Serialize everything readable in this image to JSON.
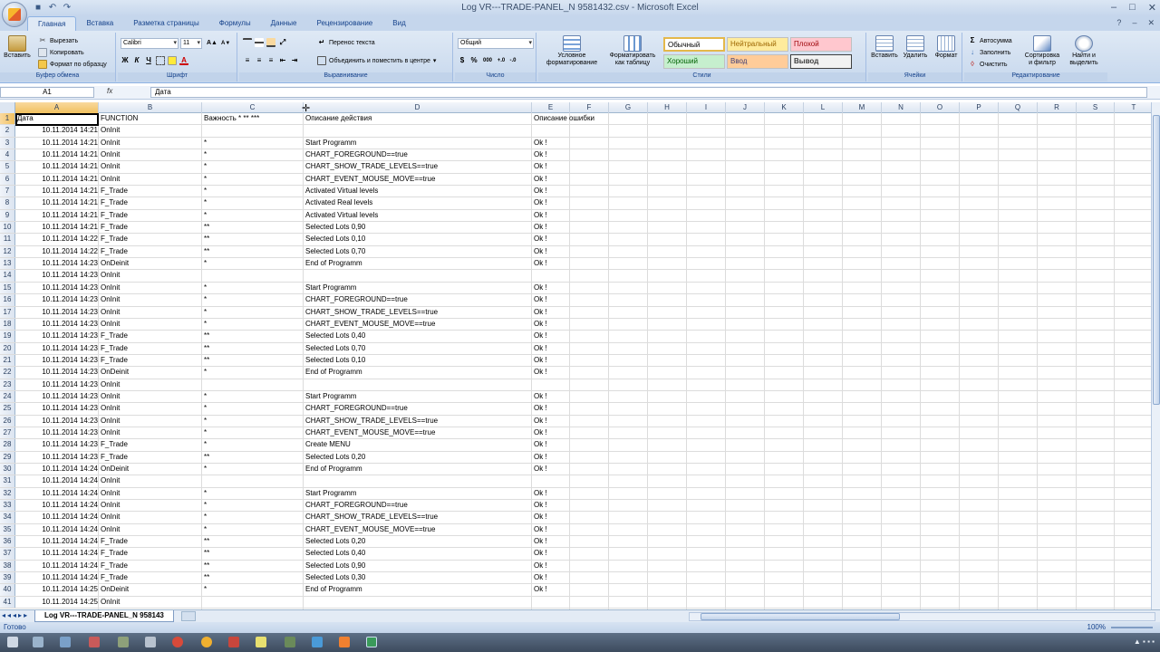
{
  "window": {
    "title": "Log VR---TRADE-PANEL_N 9581432.csv - Microsoft Excel",
    "controls": [
      "–",
      "□",
      "✕"
    ]
  },
  "tabs": [
    "Главная",
    "Вставка",
    "Разметка страницы",
    "Формулы",
    "Данные",
    "Рецензирование",
    "Вид"
  ],
  "ribbon": {
    "clipboard": {
      "label": "Буфер обмена",
      "paste": "Вставить",
      "cut": "Вырезать",
      "copy": "Копировать",
      "format_painter": "Формат по образцу"
    },
    "font": {
      "label": "Шрифт",
      "name": "Calibri",
      "size": "11",
      "bold": "Ж",
      "italic": "К",
      "underline": "Ч"
    },
    "alignment": {
      "label": "Выравнивание",
      "wrap": "Перенос текста",
      "merge": "Объединить и поместить в центре"
    },
    "number": {
      "label": "Число",
      "format": "Общий",
      "percent": "%",
      "thousands": "000"
    },
    "styles": {
      "label": "Стили",
      "cond_format": "Условное форматирование",
      "as_table": "Форматировать как таблицу",
      "normal": "Обычный",
      "neutral": "Нейтральный",
      "bad": "Плохой",
      "good": "Хороший",
      "input": "Ввод",
      "output": "Вывод"
    },
    "cells": {
      "label": "Ячейки",
      "insert": "Вставить",
      "delete": "Удалить",
      "format": "Формат"
    },
    "editing": {
      "label": "Редактирование",
      "autosum": "Автосумма",
      "fill": "Заполнить",
      "clear": "Очистить",
      "sort": "Сортировка и фильтр",
      "find": "Найти и выделить"
    }
  },
  "formula_bar": {
    "name_box": "A1",
    "fx": "fx",
    "value": "Дата"
  },
  "columns": [
    "A",
    "B",
    "C",
    "D",
    "E",
    "F",
    "G",
    "H",
    "I",
    "J",
    "K",
    "L",
    "M",
    "N",
    "O",
    "P",
    "Q",
    "R",
    "S",
    "T"
  ],
  "header_row": [
    "Дата",
    "FUNCTION",
    "Важность * ** ***",
    "Описание действия",
    "Описание ошибки"
  ],
  "rows": [
    [
      "10.11.2014 14:21",
      "OnInit",
      "",
      "",
      ""
    ],
    [
      "10.11.2014 14:21",
      "OnInit",
      "*",
      "Start Programm",
      "Ok !"
    ],
    [
      "10.11.2014 14:21",
      "OnInit",
      "*",
      "CHART_FOREGROUND==true",
      "Ok !"
    ],
    [
      "10.11.2014 14:21",
      "OnInit",
      "*",
      "CHART_SHOW_TRADE_LEVELS==true",
      "Ok !"
    ],
    [
      "10.11.2014 14:21",
      "OnInit",
      "*",
      "CHART_EVENT_MOUSE_MOVE==true",
      "Ok !"
    ],
    [
      "10.11.2014 14:21",
      "F_Trade",
      "*",
      " Activated Virtual levels",
      "Ok !"
    ],
    [
      "10.11.2014 14:21",
      "F_Trade",
      "*",
      " Activated Real levels",
      "Ok !"
    ],
    [
      "10.11.2014 14:21",
      "F_Trade",
      "*",
      " Activated Virtual levels",
      "Ok !"
    ],
    [
      "10.11.2014 14:21",
      "F_Trade",
      "**",
      " Selected Lots 0,90",
      "Ok !"
    ],
    [
      "10.11.2014 14:22",
      "F_Trade",
      "**",
      " Selected Lots 0,10",
      "Ok !"
    ],
    [
      "10.11.2014 14:22",
      "F_Trade",
      "**",
      " Selected Lots 0,70",
      "Ok !"
    ],
    [
      "10.11.2014 14:23",
      "OnDeinit",
      "*",
      "End of Programm",
      "Ok !"
    ],
    [
      "10.11.2014 14:23",
      "OnInit",
      "",
      "",
      ""
    ],
    [
      "10.11.2014 14:23",
      "OnInit",
      "*",
      "Start Programm",
      "Ok !"
    ],
    [
      "10.11.2014 14:23",
      "OnInit",
      "*",
      "CHART_FOREGROUND==true",
      "Ok !"
    ],
    [
      "10.11.2014 14:23",
      "OnInit",
      "*",
      "CHART_SHOW_TRADE_LEVELS==true",
      "Ok !"
    ],
    [
      "10.11.2014 14:23",
      "OnInit",
      "*",
      "CHART_EVENT_MOUSE_MOVE==true",
      "Ok !"
    ],
    [
      "10.11.2014 14:23",
      "F_Trade",
      "**",
      " Selected Lots 0,40",
      "Ok !"
    ],
    [
      "10.11.2014 14:23",
      "F_Trade",
      "**",
      " Selected Lots 0,70",
      "Ok !"
    ],
    [
      "10.11.2014 14:23",
      "F_Trade",
      "**",
      " Selected Lots 0,10",
      "Ok !"
    ],
    [
      "10.11.2014 14:23",
      "OnDeinit",
      "*",
      "End of Programm",
      "Ok !"
    ],
    [
      "10.11.2014 14:23",
      "OnInit",
      "",
      "",
      ""
    ],
    [
      "10.11.2014 14:23",
      "OnInit",
      "*",
      "Start Programm",
      "Ok !"
    ],
    [
      "10.11.2014 14:23",
      "OnInit",
      "*",
      "CHART_FOREGROUND==true",
      "Ok !"
    ],
    [
      "10.11.2014 14:23",
      "OnInit",
      "*",
      "CHART_SHOW_TRADE_LEVELS==true",
      "Ok !"
    ],
    [
      "10.11.2014 14:23",
      "OnInit",
      "*",
      "CHART_EVENT_MOUSE_MOVE==true",
      "Ok !"
    ],
    [
      "10.11.2014 14:23",
      "F_Trade",
      "*",
      " Create MENU",
      "Ok !"
    ],
    [
      "10.11.2014 14:23",
      "F_Trade",
      "**",
      " Selected Lots 0,20",
      "Ok !"
    ],
    [
      "10.11.2014 14:24",
      "OnDeinit",
      "*",
      "End of Programm",
      "Ok !"
    ],
    [
      "10.11.2014 14:24",
      "OnInit",
      "",
      "",
      ""
    ],
    [
      "10.11.2014 14:24",
      "OnInit",
      "*",
      "Start Programm",
      "Ok !"
    ],
    [
      "10.11.2014 14:24",
      "OnInit",
      "*",
      "CHART_FOREGROUND==true",
      "Ok !"
    ],
    [
      "10.11.2014 14:24",
      "OnInit",
      "*",
      "CHART_SHOW_TRADE_LEVELS==true",
      "Ok !"
    ],
    [
      "10.11.2014 14:24",
      "OnInit",
      "*",
      "CHART_EVENT_MOUSE_MOVE==true",
      "Ok !"
    ],
    [
      "10.11.2014 14:24",
      "F_Trade",
      "**",
      " Selected Lots 0,20",
      "Ok !"
    ],
    [
      "10.11.2014 14:24",
      "F_Trade",
      "**",
      " Selected Lots 0,40",
      "Ok !"
    ],
    [
      "10.11.2014 14:24",
      "F_Trade",
      "**",
      " Selected Lots 0,90",
      "Ok !"
    ],
    [
      "10.11.2014 14:24",
      "F_Trade",
      "**",
      " Selected Lots 0,30",
      "Ok !"
    ],
    [
      "10.11.2014 14:25",
      "OnDeinit",
      "*",
      "End of Programm",
      "Ok !"
    ],
    [
      "10.11.2014 14:25",
      "OnInit",
      "",
      "",
      ""
    ]
  ],
  "sheet_tab": "Log VR---TRADE-PANEL_N 958143",
  "status": "Готово",
  "zoom": "100%",
  "colors": {
    "accent": "#15428b",
    "selection": "#f1c15f",
    "ribbon": "#dfe9f5"
  }
}
